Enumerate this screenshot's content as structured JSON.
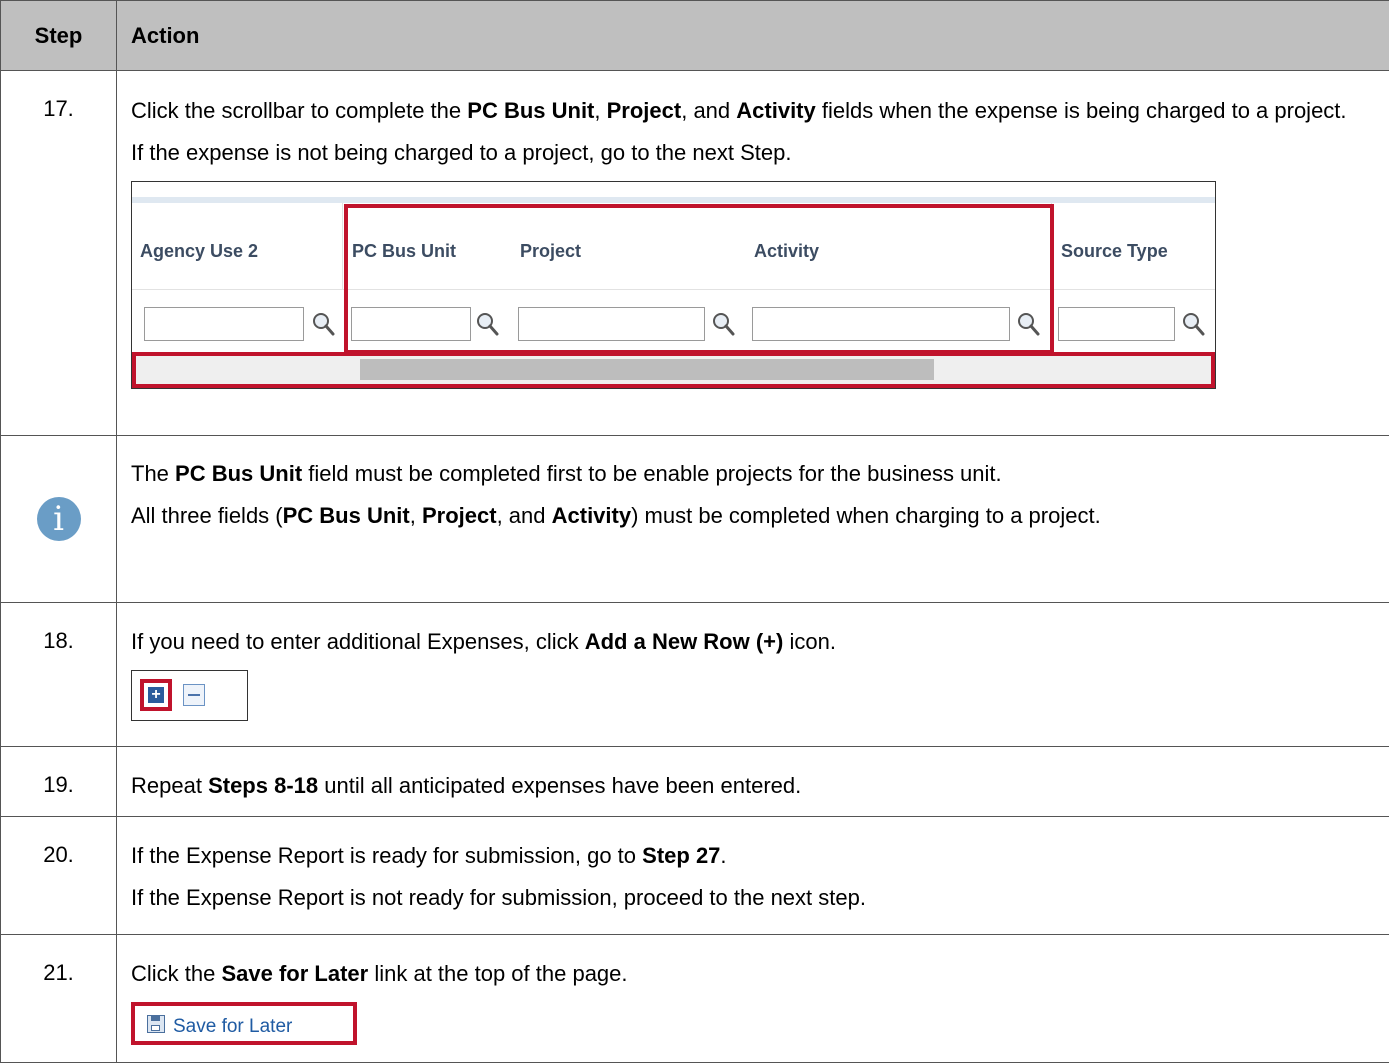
{
  "header": {
    "step": "Step",
    "action": "Action"
  },
  "row17": {
    "num": "17.",
    "p1": [
      "Click the scrollbar to complete the ",
      "PC Bus Unit",
      ", ",
      "Project",
      ", and ",
      "Activity",
      " fields when the expense is being charged to a project."
    ],
    "p2": "If the expense is not being charged to a project, go to the next Step.",
    "grid": {
      "columns": [
        "Agency Use 2",
        "PC Bus Unit",
        "Project",
        "Activity",
        "Source Type"
      ],
      "lookup_icon": "magnifier-icon",
      "highlight_color": "#c0132c"
    }
  },
  "info": {
    "icon": "info-icon",
    "p1": [
      "The ",
      "PC Bus Unit",
      " field must be completed first to be enable projects for the business unit."
    ],
    "p2": [
      "All three fields (",
      "PC Bus Unit",
      ", ",
      "Project",
      ", and ",
      "Activity",
      ") must be completed when charging to a project."
    ]
  },
  "row18": {
    "num": "18.",
    "p1": [
      "If you need to enter additional Expenses, click ",
      "Add a New Row (+)",
      " icon."
    ],
    "icons": [
      "add-row-icon",
      "delete-row-icon"
    ]
  },
  "row19": {
    "num": "19.",
    "p1": [
      "Repeat ",
      "Steps 8-18",
      " until all anticipated expenses have been entered."
    ]
  },
  "row20": {
    "num": "20.",
    "p1": [
      "If the Expense Report is ready for submission, go to ",
      "Step 27",
      "."
    ],
    "p2": "If the Expense Report is not ready for submission, proceed to the next step."
  },
  "row21": {
    "num": "21.",
    "p1": [
      "Click the ",
      "Save for Later",
      " link at the top of the page."
    ],
    "link_label": "Save for Later",
    "link_icon": "save-disk-icon"
  }
}
